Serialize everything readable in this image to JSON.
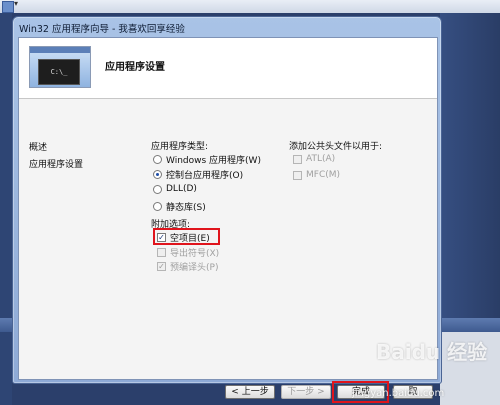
{
  "window": {
    "title": "Win32 应用程序向导 - 我喜欢回享经验"
  },
  "header": {
    "title": "应用程序设置",
    "console_text": "C:\\_"
  },
  "sidebar": {
    "items": [
      {
        "label": "概述"
      },
      {
        "label": "应用程序设置"
      }
    ]
  },
  "app_type": {
    "label": "应用程序类型:",
    "options": [
      {
        "label": "Windows 应用程序(W)",
        "selected": false
      },
      {
        "label": "控制台应用程序(O)",
        "selected": true
      },
      {
        "label": "DLL(D)",
        "selected": false
      },
      {
        "label": "静态库(S)",
        "selected": false
      }
    ]
  },
  "extra_options": {
    "label": "附加选项:",
    "items": [
      {
        "label": "空项目(E)",
        "checked": true,
        "enabled": true
      },
      {
        "label": "导出符号(X)",
        "checked": false,
        "enabled": false
      },
      {
        "label": "预编译头(P)",
        "checked": true,
        "enabled": false
      }
    ]
  },
  "common_headers": {
    "label": "添加公共头文件以用于:",
    "items": [
      {
        "label": "ATL(A)",
        "checked": false,
        "enabled": false
      },
      {
        "label": "MFC(M)",
        "checked": false,
        "enabled": false
      }
    ]
  },
  "buttons": {
    "prev": "< 上一步",
    "next": "下一步 >",
    "finish": "完成",
    "cancel": "取"
  },
  "watermark": {
    "logo": "Baidu 经验",
    "url": "jingyan.baidu.com"
  },
  "colors": {
    "highlight": "#e0141c",
    "title_bar": "#a9c3e6"
  }
}
